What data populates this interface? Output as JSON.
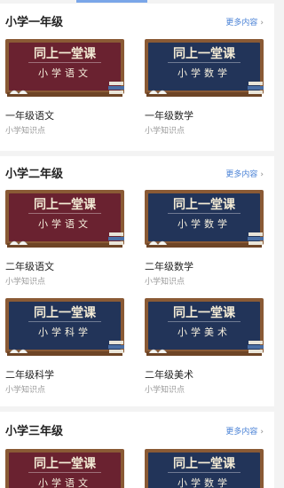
{
  "sections": [
    {
      "title": "小学一年级",
      "more": "更多内容",
      "cards": [
        {
          "board_title": "同上一堂课",
          "board_sub": "小学语文",
          "title": "一年级语文",
          "sub": "小学知识点",
          "board_color": "#6a2230"
        },
        {
          "board_title": "同上一堂课",
          "board_sub": "小学数学",
          "title": "一年级数学",
          "sub": "小学知识点",
          "board_color": "#223459"
        }
      ]
    },
    {
      "title": "小学二年级",
      "more": "更多内容",
      "cards": [
        {
          "board_title": "同上一堂课",
          "board_sub": "小学语文",
          "title": "二年级语文",
          "sub": "小学知识点",
          "board_color": "#6a2230"
        },
        {
          "board_title": "同上一堂课",
          "board_sub": "小学数学",
          "title": "二年级数学",
          "sub": "小学知识点",
          "board_color": "#223459"
        },
        {
          "board_title": "同上一堂课",
          "board_sub": "小学科学",
          "title": "二年级科学",
          "sub": "小学知识点",
          "board_color": "#223459"
        },
        {
          "board_title": "同上一堂课",
          "board_sub": "小学美术",
          "title": "二年级美术",
          "sub": "小学知识点",
          "board_color": "#223459"
        }
      ]
    },
    {
      "title": "小学三年级",
      "more": "更多内容",
      "cards": [
        {
          "board_title": "同上一堂课",
          "board_sub": "小学语文",
          "board_color": "#6a2230"
        },
        {
          "board_title": "同上一堂课",
          "board_sub": "小学数学",
          "board_color": "#223459"
        }
      ]
    }
  ],
  "icons": {
    "more_chevron": "chevron-right-icon",
    "book": "book-stack-icon",
    "open_book": "open-book-icon"
  }
}
